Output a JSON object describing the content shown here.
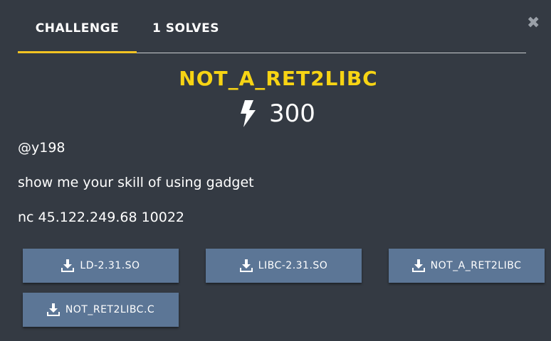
{
  "modal": {
    "close_glyph": "✖"
  },
  "tabs": [
    {
      "label": "Challenge",
      "active": true
    },
    {
      "label": "1 Solves",
      "active": false
    }
  ],
  "challenge": {
    "name": "not_a_ret2libc",
    "points": "300",
    "author": "@y198",
    "description_lines": [
      "show me your skill of using gadget",
      "nc 45.122.249.68 10022"
    ]
  },
  "files": [
    {
      "label": "LD-2.31.SO",
      "icon": "download-icon"
    },
    {
      "label": "LIBC-2.31.SO",
      "icon": "download-icon"
    },
    {
      "label": "NOT_A_RET2LIBC",
      "icon": "download-icon"
    },
    {
      "label": "NOT_RET2LIBC.C",
      "icon": "download-icon"
    }
  ],
  "colors": {
    "background": "#343a43",
    "accent": "#f7d414",
    "tab_underline": "#f3c322",
    "button": "#5c7696"
  }
}
